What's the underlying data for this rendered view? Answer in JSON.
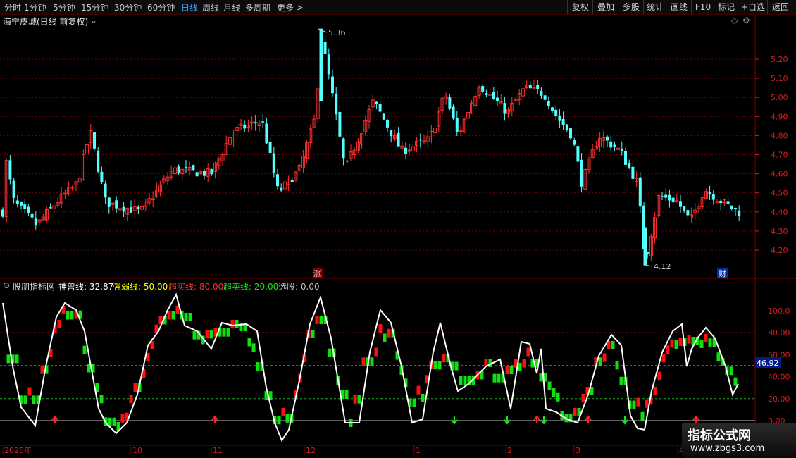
{
  "timeframes": [
    "分时",
    "1分钟",
    "5分钟",
    "15分钟",
    "30分钟",
    "60分钟",
    "日线",
    "周线",
    "月线",
    "多周期",
    "更多"
  ],
  "active_timeframe": "日线",
  "toolbar_buttons": [
    "复权",
    "叠加",
    "多股",
    "统计",
    "画线",
    "F10",
    "标记",
    "+自选",
    "返回"
  ],
  "main_chart": {
    "title": "海宁皮城(日线 前复权)",
    "price_ticks": [
      "5.20",
      "5.10",
      "5.00",
      "4.90",
      "4.80",
      "4.70",
      "4.60",
      "4.50",
      "4.40",
      "4.30",
      "4.20"
    ],
    "high_marker": "5.36",
    "low_marker": "4.12",
    "badge_zhang": "涨",
    "badge_cai": "财"
  },
  "indicator": {
    "name": "股朋指标网",
    "values": [
      {
        "label": "神兽线:",
        "value": "32.87",
        "color": "#ffffff"
      },
      {
        "label": "强弱线:",
        "value": "50.00",
        "color": "#ffff00"
      },
      {
        "label": "超买线:",
        "value": "80.00",
        "color": "#ff3030"
      },
      {
        "label": "超卖线:",
        "value": "20.00",
        "color": "#20e020"
      },
      {
        "label": "选股:",
        "value": "0.00",
        "color": "#c0c0c0"
      }
    ],
    "ticks": [
      "100.0",
      "80.00",
      "60.00",
      "40.00",
      "20.00",
      "0.00"
    ],
    "current_value": "46.92"
  },
  "date_axis": [
    "2025年",
    "10",
    "11",
    "12",
    "1",
    "2",
    "3",
    "4"
  ],
  "watermark": {
    "title": "指标公式网",
    "url": "www.zbgs3.com"
  },
  "colors": {
    "up": "#ff3030",
    "down": "#54ffff",
    "accent": "#3aa0ff",
    "gridline": "#7a0000"
  }
}
